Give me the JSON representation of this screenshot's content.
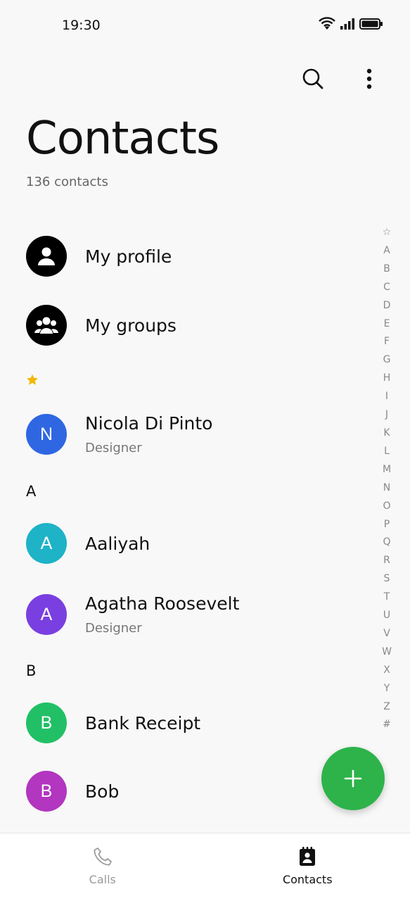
{
  "status": {
    "time": "19:30"
  },
  "header": {
    "title": "Contacts",
    "count": "136 contacts"
  },
  "specials": [
    {
      "label": "My profile"
    },
    {
      "label": "My groups"
    }
  ],
  "sections": {
    "a": "A",
    "b": "B"
  },
  "contacts": {
    "nicola": {
      "initial": "N",
      "name": "Nicola Di Pinto",
      "subtitle": "Designer",
      "color": "#2f67e3"
    },
    "aaliyah": {
      "initial": "A",
      "name": "Aaliyah",
      "color": "#1eb3c7"
    },
    "agatha": {
      "initial": "A",
      "name": "Agatha Roosevelt",
      "subtitle": "Designer",
      "color": "#7a3fe0"
    },
    "bank": {
      "initial": "B",
      "name": "Bank Receipt",
      "color": "#22c066"
    },
    "bob": {
      "initial": "B",
      "name": "Bob",
      "color": "#b236bf"
    }
  },
  "alpha_index": [
    "☆",
    "A",
    "B",
    "C",
    "D",
    "E",
    "F",
    "G",
    "H",
    "I",
    "J",
    "K",
    "L",
    "M",
    "N",
    "O",
    "P",
    "Q",
    "R",
    "S",
    "T",
    "U",
    "V",
    "W",
    "X",
    "Y",
    "Z",
    "#"
  ],
  "nav": {
    "calls": "Calls",
    "contacts": "Contacts"
  },
  "colors": {
    "fab": "#2db34a",
    "star": "#f5b800"
  }
}
